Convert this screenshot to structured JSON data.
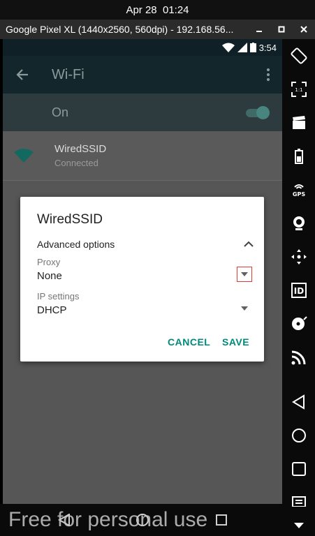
{
  "topbar": {
    "datetime": "Apr 28  01:24"
  },
  "titlebar": {
    "title": "Google Pixel XL (1440x2560, 560dpi) - 192.168.56..."
  },
  "status": {
    "time": "3:54"
  },
  "appbar": {
    "title": "Wi-Fi"
  },
  "wifi_toggle": {
    "label": "On"
  },
  "network": {
    "ssid": "WiredSSID",
    "status": "Connected"
  },
  "dialog": {
    "title": "WiredSSID",
    "advanced_label": "Advanced options",
    "proxy_label": "Proxy",
    "proxy_value": "None",
    "ip_label": "IP settings",
    "ip_value": "DHCP",
    "cancel_label": "CANCEL",
    "save_label": "SAVE"
  },
  "watermark": "Free for personal use",
  "colors": {
    "accent": "#00897b",
    "highlight": "#e53935"
  }
}
